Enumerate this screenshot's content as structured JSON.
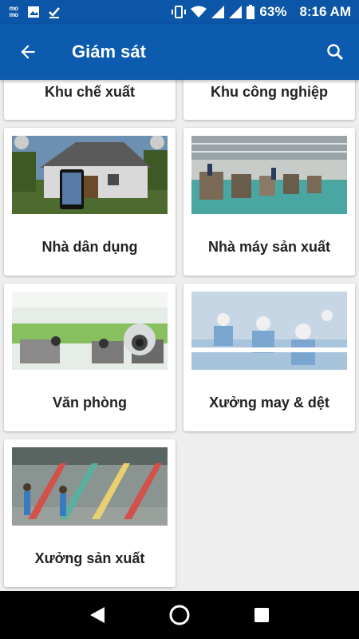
{
  "status_bar": {
    "app_icon_text": "mo mo",
    "battery": "63%",
    "time": "8:16 AM"
  },
  "app_bar": {
    "title": "Giám sát"
  },
  "categories": [
    {
      "label": "Khu chế xuất"
    },
    {
      "label": "Khu công nghiệp"
    },
    {
      "label": "Nhà dân dụng"
    },
    {
      "label": "Nhà máy sản xuất"
    },
    {
      "label": "Văn phòng"
    },
    {
      "label": "Xưởng may & dệt"
    },
    {
      "label": "Xưởng sản xuất"
    }
  ],
  "colors": {
    "primary": "#0c5bae",
    "status_bar": "#0b56a6",
    "background": "#eeeeee"
  }
}
